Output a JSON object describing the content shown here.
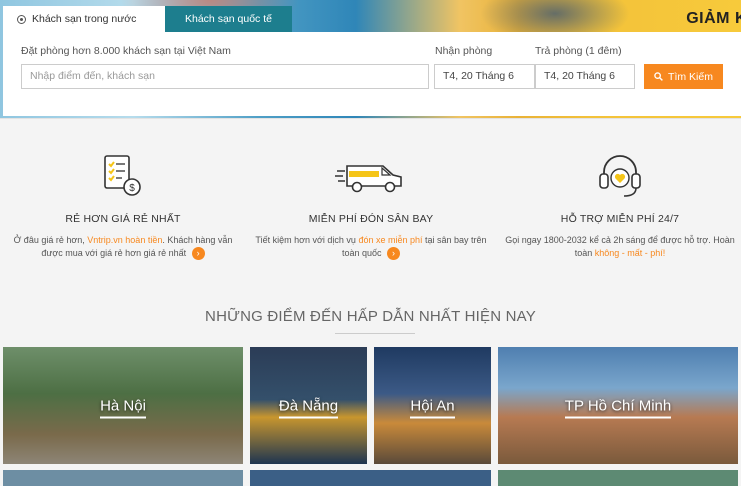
{
  "hero": {
    "promo_text": "GIẢM K"
  },
  "tabs": [
    {
      "label": "Khách sạn trong nước"
    },
    {
      "label": "Khách sạn quốc tế"
    }
  ],
  "search": {
    "destination_label": "Đặt phòng hơn 8.000 khách sạn tại Việt Nam",
    "destination_placeholder": "Nhập điểm đến, khách sạn",
    "checkin_label": "Nhận phòng",
    "checkin_value": "T4, 20 Tháng 6",
    "checkout_label": "Trả phòng (1 đêm)",
    "checkout_value": "T4, 20 Tháng 6",
    "button_label": "Tìm Kiếm"
  },
  "features": [
    {
      "title": "RẺ HƠN GIÁ RẺ NHẤT",
      "text_1": "Ở đâu giá rẻ hơn,",
      "highlight": "Vntrip.vn hoàn tiền",
      "text_2": ". Khách hàng vẫn được mua với giá rẻ hơn giá rẻ nhất"
    },
    {
      "title": "MIỄN PHÍ ĐÓN SÂN BAY",
      "text_1": "Tiết kiệm hơn với dịch vụ",
      "highlight": "đón xe miễn phí",
      "text_2": "tại sân bay trên toàn quốc"
    },
    {
      "title": "HỖ TRỢ MIỄN PHÍ 24/7",
      "text_1": "Gọi ngay 1800-2032 kể cả 2h sáng để được hỗ trợ. Hoàn toàn",
      "highlight": "không - mất - phí!",
      "text_2": ""
    }
  ],
  "destinations_title": "NHỮNG ĐIỂM ĐẾN HẤP DẪN NHẤT HIỆN NAY",
  "destinations": [
    {
      "name": "Hà Nội"
    },
    {
      "name": "Đà Nẵng"
    },
    {
      "name": "Hội An"
    },
    {
      "name": "TP Hồ Chí Minh"
    }
  ],
  "colors": {
    "accent": "#f7881f",
    "tab_inactive": "#1d7e8e"
  }
}
